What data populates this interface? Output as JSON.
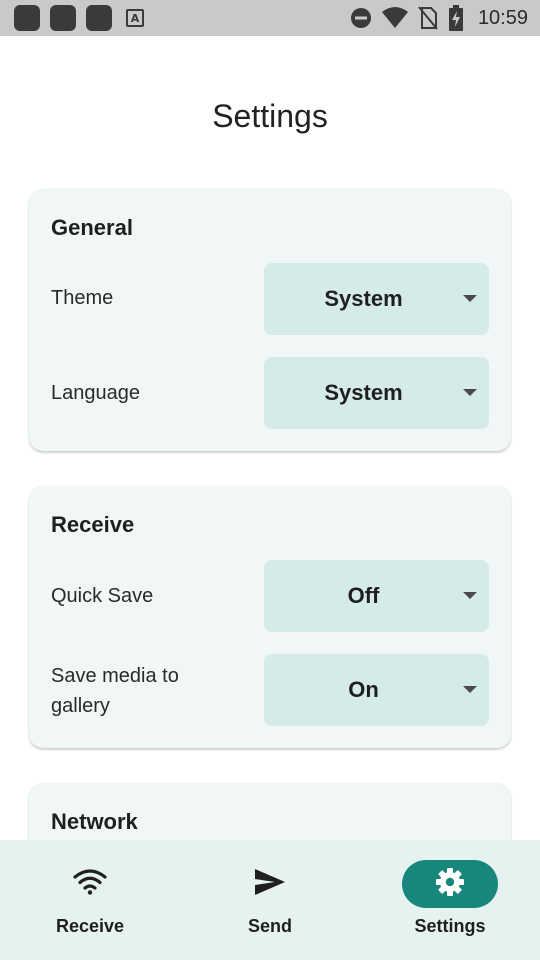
{
  "status_bar": {
    "time": "10:59",
    "notification_icons": [
      "app-notification-icon",
      "app-notification-icon",
      "app-notification-icon",
      "text-a-icon"
    ],
    "text_a_label": "A",
    "system_icons": [
      "do-not-disturb-icon",
      "wifi-icon",
      "no-sim-icon",
      "battery-charging-icon"
    ]
  },
  "page": {
    "title": "Settings"
  },
  "sections": [
    {
      "title": "General",
      "rows": [
        {
          "label": "Theme",
          "value": "System"
        },
        {
          "label": "Language",
          "value": "System"
        }
      ]
    },
    {
      "title": "Receive",
      "rows": [
        {
          "label": "Quick Save",
          "value": "Off"
        },
        {
          "label": "Save media to gallery",
          "value": "On"
        }
      ]
    },
    {
      "title": "Network",
      "rows": []
    }
  ],
  "bottom_nav": {
    "items": [
      {
        "label": "Receive",
        "icon": "wifi-icon",
        "active": false
      },
      {
        "label": "Send",
        "icon": "send-icon",
        "active": false
      },
      {
        "label": "Settings",
        "icon": "gear-icon",
        "active": true
      }
    ]
  },
  "colors": {
    "accent": "#16877a",
    "card_background": "#f0f7f6",
    "dropdown_background": "#d4ebe8",
    "nav_background": "#e6f2f0"
  }
}
